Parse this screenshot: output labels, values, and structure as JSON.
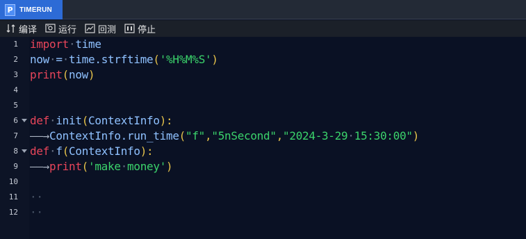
{
  "tab": {
    "label": "TIMERUN",
    "icon": "python-file-icon",
    "icon_glyph": "P"
  },
  "toolbar": {
    "compile_label": "编译",
    "run_label": "运行",
    "backtest_label": "回测",
    "stop_label": "停止"
  },
  "gutter": {
    "lines": [
      "1",
      "2",
      "3",
      "4",
      "5",
      "6",
      "7",
      "8",
      "9",
      "10",
      "11",
      "12"
    ]
  },
  "code": {
    "l1": {
      "kw": "import",
      "sp": "·",
      "mod": "time"
    },
    "l2": {
      "var": "now",
      "sp1": "·",
      "eq": "=",
      "sp2": "·",
      "call": "time.strftime",
      "lp": "(",
      "str": "'%H%M%S'",
      "rp": ")"
    },
    "l3": {
      "kw": "print",
      "lp": "(",
      "arg": "now",
      "rp": ")"
    },
    "l6": {
      "kw": "def",
      "sp": "·",
      "fn": "init",
      "lp": "(",
      "param": "ContextInfo",
      "rp": "):"
    },
    "l7": {
      "tab": "——→",
      "call": "ContextInfo.run_time",
      "lp": "(",
      "s1": "\"f\"",
      "c1": ",",
      "s2": "\"5nSecond\"",
      "c2": ",",
      "s3a": "\"2024-3-29",
      "sp": "·",
      "s3b": "15:30:00\"",
      "rp": ")"
    },
    "l8": {
      "kw": "def",
      "sp": "·",
      "fn": "f",
      "lp": "(",
      "param": "ContextInfo",
      "rp": "):"
    },
    "l9": {
      "tab": "——→",
      "kw": "print",
      "lp": "(",
      "s1": "'make",
      "sp": "·",
      "s2": "money'",
      "rp": ")"
    },
    "l11": {
      "ws": "··"
    },
    "l12": {
      "ws": "··"
    }
  },
  "colors": {
    "keyword": "#e8455a",
    "identifier": "#8fc1ff",
    "punctuation": "#e6c24a",
    "string": "#3bd36b",
    "tab_active": "#2d6bd6",
    "editor_bg": "#0a1124"
  }
}
